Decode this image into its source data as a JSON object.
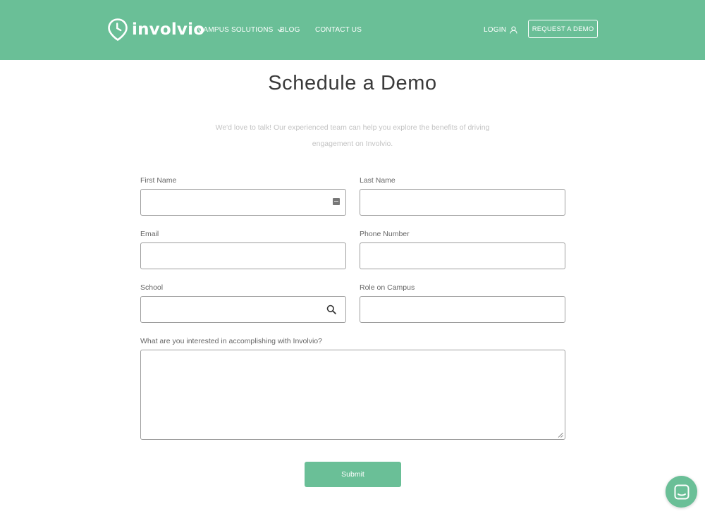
{
  "brand": {
    "name": "involvio",
    "accent": "#6abf97"
  },
  "nav": {
    "campus_solutions": "CAMPUS SOLUTIONS",
    "blog": "BLOG",
    "contact": "CONTACT US",
    "login": "LOGIN",
    "request_demo": "REQUEST A DEMO"
  },
  "page": {
    "title": "Schedule a Demo",
    "intro": "We'd love to talk! Our experienced team can help you explore the benefits of driving engagement on Involvio."
  },
  "form": {
    "first_name_label": "First Name",
    "first_name_value": "",
    "last_name_label": "Last Name",
    "last_name_value": "",
    "email_label": "Email",
    "email_value": "",
    "phone_label": "Phone Number",
    "phone_value": "",
    "school_label": "School",
    "school_value": "",
    "role_label": "Role on Campus",
    "role_value": "",
    "interest_label": "What are you interested in accomplishing with Involvio?",
    "interest_value": "",
    "submit_label": "Submit"
  },
  "icons": {
    "logo": "location-pin-clock-icon",
    "nav_dropdown": "chevron-down-icon",
    "login": "user-icon",
    "first_name_autofill": "contact-card-icon",
    "school_search": "search-icon",
    "chat": "chat-bubble-icon"
  }
}
